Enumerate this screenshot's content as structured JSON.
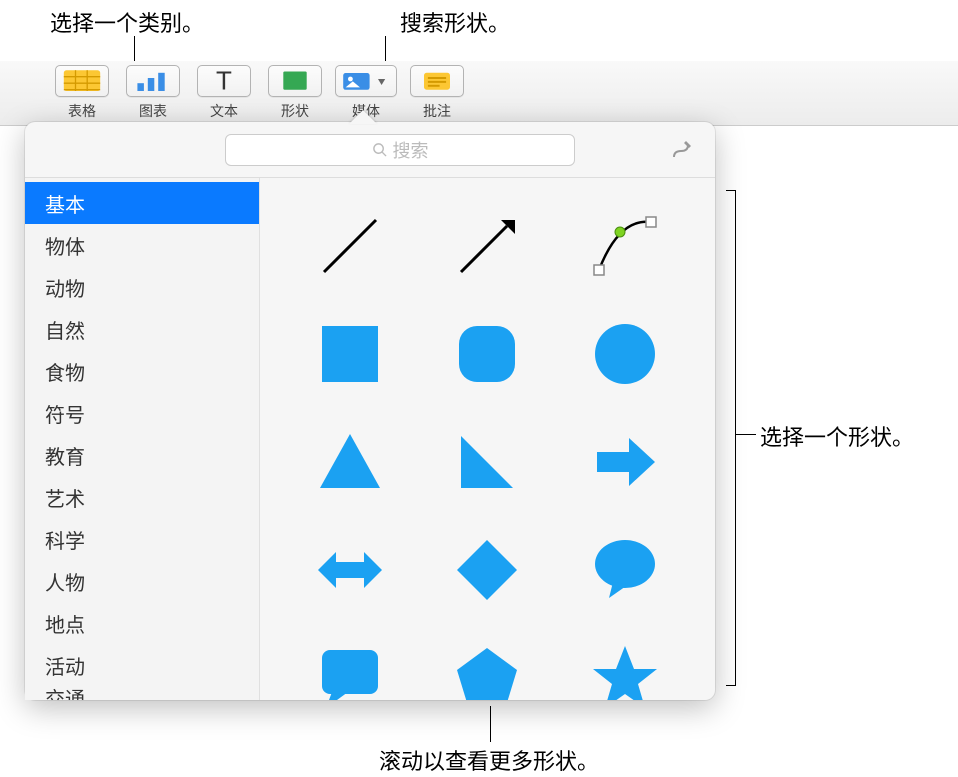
{
  "callouts": {
    "select_category": "选择一个类别。",
    "search_shapes": "搜索形状。",
    "select_shape": "选择一个形状。",
    "scroll_more": "滚动以查看更多形状。"
  },
  "toolbar": {
    "table": "表格",
    "chart": "图表",
    "text": "文本",
    "shape": "形状",
    "media": "媒体",
    "comment": "批注"
  },
  "search": {
    "placeholder": "搜索"
  },
  "sidebar": {
    "items": [
      {
        "label": "基本",
        "selected": true
      },
      {
        "label": "物体"
      },
      {
        "label": "动物"
      },
      {
        "label": "自然"
      },
      {
        "label": "食物"
      },
      {
        "label": "符号"
      },
      {
        "label": "教育"
      },
      {
        "label": "艺术"
      },
      {
        "label": "科学"
      },
      {
        "label": "人物"
      },
      {
        "label": "地点"
      },
      {
        "label": "活动"
      }
    ],
    "partial": "交通"
  },
  "shapes": [
    {
      "name": "line"
    },
    {
      "name": "arrow-line"
    },
    {
      "name": "bezier-curve"
    },
    {
      "name": "square"
    },
    {
      "name": "rounded-square"
    },
    {
      "name": "circle"
    },
    {
      "name": "triangle"
    },
    {
      "name": "right-triangle"
    },
    {
      "name": "arrow-right"
    },
    {
      "name": "arrow-horizontal"
    },
    {
      "name": "diamond"
    },
    {
      "name": "speech-bubble"
    },
    {
      "name": "callout-box"
    },
    {
      "name": "pentagon"
    },
    {
      "name": "star"
    }
  ],
  "colors": {
    "shape_fill": "#1ba1f2",
    "toolbar_yellow": "#fcc733",
    "toolbar_blue": "#3a8ee6",
    "toolbar_green": "#35a853"
  }
}
